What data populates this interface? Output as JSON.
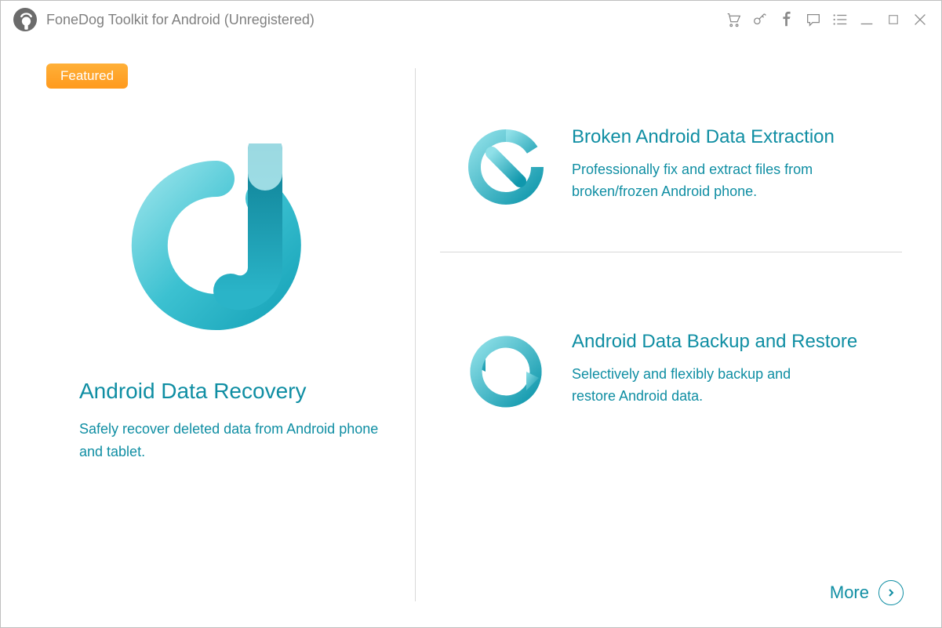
{
  "titlebar": {
    "title": "FoneDog Toolkit for Android (Unregistered)"
  },
  "featured_label": "Featured",
  "left": {
    "title": "Android Data Recovery",
    "desc": "Safely recover deleted data from Android phone and tablet."
  },
  "right": {
    "items": [
      {
        "title": "Broken Android Data Extraction",
        "desc": "Professionally fix and extract files from broken/frozen Android phone."
      },
      {
        "title": "Android Data Backup and Restore",
        "desc": "Selectively and flexibly backup and restore Android data."
      }
    ]
  },
  "more_label": "More",
  "colors": {
    "accent": "#0f8ea3",
    "badge_start": "#ffb038",
    "badge_end": "#ff9a1e",
    "icon_grey": "#8a8a8a"
  }
}
